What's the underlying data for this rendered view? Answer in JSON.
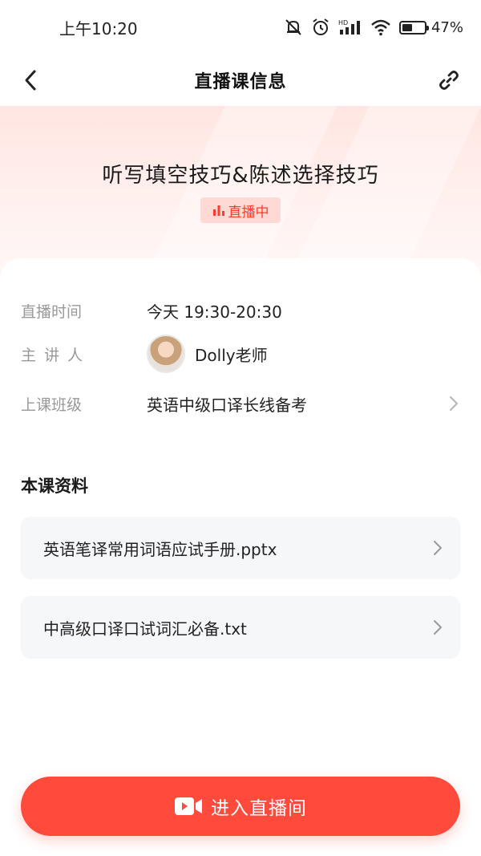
{
  "status_bar": {
    "time": "上午10:20",
    "battery_percent": "47%",
    "battery_level": 0.47
  },
  "nav": {
    "title": "直播课信息",
    "back_icon": "chevron-left-icon",
    "share_icon": "link-icon"
  },
  "hero": {
    "title": "听写填空技巧&陈述选择技巧",
    "live_badge": "直播中"
  },
  "info": {
    "time_label": "直播时间",
    "time_value": "今天 19:30-20:30",
    "teacher_label": "主 讲 人",
    "teacher_name": "Dolly老师",
    "class_label": "上课班级",
    "class_value": "英语中级口译长线备考"
  },
  "materials": {
    "title": "本课资料",
    "items": [
      {
        "name": "英语笔译常用词语应试手册.pptx"
      },
      {
        "name": "中高级口译口试词汇必备.txt"
      }
    ]
  },
  "cta": {
    "label": "进入直播间"
  },
  "colors": {
    "accent": "#ff4a3c",
    "live_text": "#ff3b2b",
    "live_bg": "#ffd9d4",
    "label_gray": "#999999"
  }
}
